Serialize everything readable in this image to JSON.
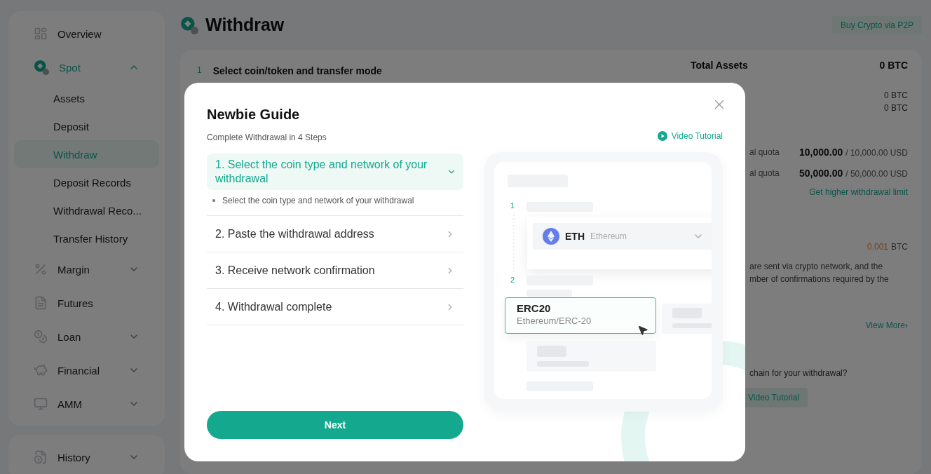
{
  "sidebar": {
    "items": [
      {
        "label": "Overview",
        "kind": "link",
        "selected": false
      },
      {
        "label": "Spot",
        "kind": "group",
        "selected": true,
        "expanded": true,
        "children": [
          {
            "label": "Assets",
            "selected": false
          },
          {
            "label": "Deposit",
            "selected": false
          },
          {
            "label": "Withdraw",
            "selected": true
          },
          {
            "label": "Deposit Records",
            "selected": false
          },
          {
            "label": "Withdrawal Reco...",
            "selected": false
          },
          {
            "label": "Transfer History",
            "selected": false
          }
        ]
      },
      {
        "label": "Margin",
        "kind": "group",
        "selected": false,
        "expanded": false
      },
      {
        "label": "Futures",
        "kind": "link",
        "selected": false
      },
      {
        "label": "Loan",
        "kind": "group",
        "selected": false,
        "expanded": false
      },
      {
        "label": "Financial",
        "kind": "group",
        "selected": false,
        "expanded": false
      },
      {
        "label": "AMM",
        "kind": "group",
        "selected": false,
        "expanded": false
      }
    ],
    "bottom_items": [
      {
        "label": "History",
        "kind": "group",
        "selected": false,
        "expanded": false
      }
    ]
  },
  "header": {
    "title": "Withdraw",
    "button": "Buy Crypto via P2P"
  },
  "card": {
    "step_number": "1",
    "step_title": "Select coin/token and transfer mode",
    "total_label": "Total Assets",
    "total_value": "0 BTC",
    "balances": [
      "0 BTC",
      "0 BTC"
    ],
    "quotas": [
      {
        "label": "al quota",
        "used": "10,000.00",
        "limit": "/ 10,000.00 USD"
      },
      {
        "label": "al quota",
        "used": "50,000.00",
        "limit": "/ 50,000.00 USD"
      }
    ],
    "limit_link": "Get higher withdrawal limit",
    "fee_amount": "0.001",
    "fee_unit": "BTC",
    "notice_lines": [
      "are sent via crypto network, and the",
      "mber of confirmations required by the"
    ],
    "view_more": "View More›",
    "question": "chain for your withdrawal?",
    "video_button": "Video Tutorial"
  },
  "modal": {
    "title": "Newbie Guide",
    "subtitle": "Complete Withdrawal in 4 Steps",
    "video_link": "Video Tutorial",
    "steps": [
      {
        "title": "1. Select the coin type and network of your withdrawal",
        "expanded": true,
        "detail": "Select the coin type and network of your withdrawal"
      },
      {
        "title": "2. Paste the withdrawal address",
        "expanded": false
      },
      {
        "title": "3. Receive network confirmation",
        "expanded": false
      },
      {
        "title": "4. Withdrawal complete",
        "expanded": false
      }
    ],
    "illustration": {
      "step_one": "1",
      "coin_symbol": "ETH",
      "coin_name": "Ethereum",
      "step_two": "2",
      "network": "ERC20",
      "network_detail": "Ethereum/ERC-20"
    },
    "next_button": "Next"
  }
}
